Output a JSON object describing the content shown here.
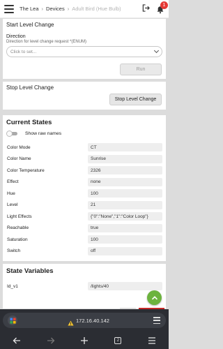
{
  "breadcrumb": {
    "items": [
      "The Lea",
      "Devices",
      "Adult Bird (Hue Bulb)"
    ]
  },
  "notifications": {
    "count": "1"
  },
  "start_level": {
    "title": "Start Level Change",
    "direction_label": "Direction",
    "direction_help": "Direction for level change request *(ENUM)",
    "select_placeholder": "Click to set...",
    "run_label": "Run"
  },
  "stop_level": {
    "title": "Stop Level Change",
    "button_label": "Stop Level Change"
  },
  "current_states": {
    "title": "Current States",
    "toggle_label": "Show raw names",
    "rows": [
      {
        "key": "Color Mode",
        "value": "CT"
      },
      {
        "key": "Color Name",
        "value": "Sunrise"
      },
      {
        "key": "Color Temperature",
        "value": "2326"
      },
      {
        "key": "Effect",
        "value": "none"
      },
      {
        "key": "Hue",
        "value": "100"
      },
      {
        "key": "Level",
        "value": "21"
      },
      {
        "key": "Light Effects",
        "value": "{\"0\":\"None\",\"1\":\"Color Loop\"}"
      },
      {
        "key": "Reachable",
        "value": "true"
      },
      {
        "key": "Saturation",
        "value": "100"
      },
      {
        "key": "Switch",
        "value": "off"
      }
    ]
  },
  "state_variables": {
    "title": "State Variables",
    "rows": [
      {
        "key": "Id_v1",
        "value": "/lights/40"
      }
    ]
  },
  "browser": {
    "url": "172.16.40.142",
    "tab_count": "2"
  },
  "colors": {
    "accent_green": "#6cb33e",
    "danger_red": "#c62828",
    "badge_red": "#e53935"
  }
}
